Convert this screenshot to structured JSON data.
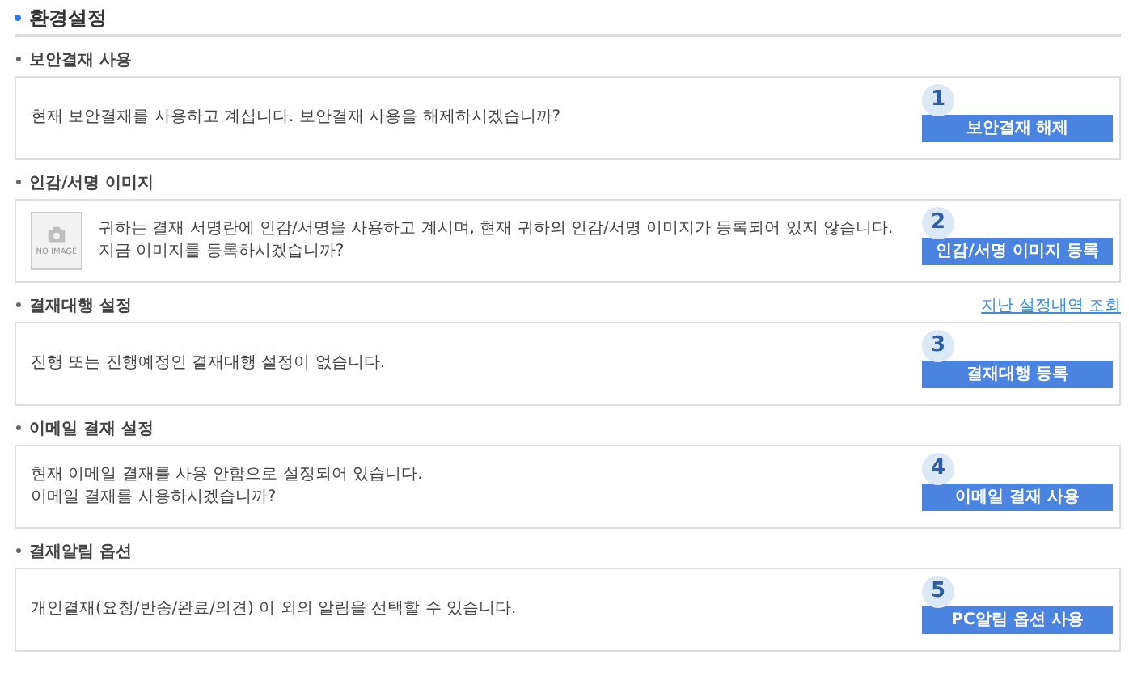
{
  "title": "환경설정",
  "sections": [
    {
      "heading": "보안결재 사용",
      "kind": "text",
      "lines": [
        "현재 보안결재를 사용하고 계십니다. 보안결재 사용을 해제하시겠습니까?"
      ],
      "badge": "1",
      "button": "보안결재 해제"
    },
    {
      "heading": "인감/서명 이미지",
      "kind": "image",
      "image_label": "NO IMAGE",
      "lines": [
        "귀하는 결재 서명란에 인감/서명을 사용하고 계시며, 현재 귀하의 인감/서명 이미지가 등록되어 있지 않습니다.",
        "지금 이미지를 등록하시겠습니까?"
      ],
      "badge": "2",
      "button": "인감/서명 이미지 등록"
    },
    {
      "heading": "결재대행 설정",
      "kind": "text",
      "link": "지난 설정내역 조회",
      "lines": [
        "진행 또는 진행예정인 결재대행 설정이 없습니다."
      ],
      "badge": "3",
      "button": "결재대행 등록"
    },
    {
      "heading": "이메일 결재 설정",
      "kind": "text",
      "lines": [
        "현재 이메일 결재를 사용 안함으로 설정되어 있습니다.",
        "이메일 결재를 사용하시겠습니까?"
      ],
      "badge": "4",
      "button": "이메일 결재 사용"
    },
    {
      "heading": "결재알림 옵션",
      "kind": "text",
      "lines": [
        "개인결재(요청/반송/완료/의견) 이 외의 알림을 선택할 수 있습니다."
      ],
      "badge": "5",
      "button": "PC알림 옵션 사용"
    }
  ]
}
